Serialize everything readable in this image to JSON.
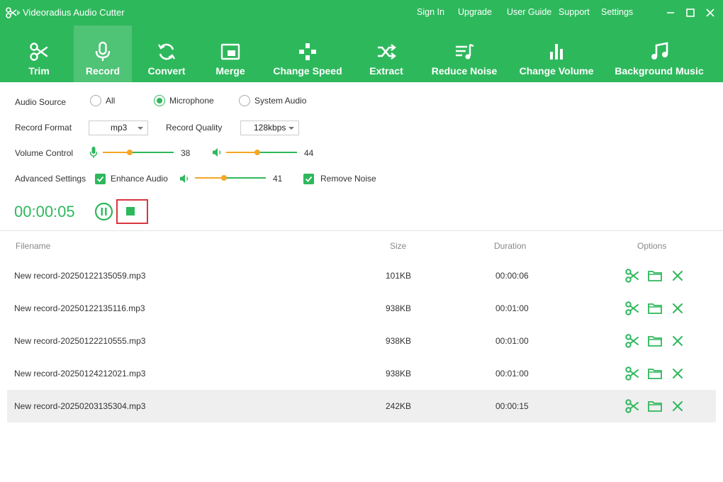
{
  "app": {
    "title": "Videoradius Audio Cutter"
  },
  "topnav": [
    "Sign In",
    "Upgrade",
    "User Guide",
    "Support",
    "Settings"
  ],
  "toolbar": [
    {
      "label": "Trim",
      "icon": "scissors-icon"
    },
    {
      "label": "Record",
      "icon": "microphone-icon",
      "active": true
    },
    {
      "label": "Convert",
      "icon": "refresh-icon"
    },
    {
      "label": "Merge",
      "icon": "merge-icon"
    },
    {
      "label": "Change Speed",
      "icon": "gamepad-icon"
    },
    {
      "label": "Extract",
      "icon": "shuffle-icon"
    },
    {
      "label": "Reduce Noise",
      "icon": "noise-icon"
    },
    {
      "label": "Change Volume",
      "icon": "bar-chart-icon"
    },
    {
      "label": "Background Music",
      "icon": "music-note-icon"
    }
  ],
  "settings": {
    "audio_source_label": "Audio Source",
    "audio_sources": [
      "All",
      "Microphone",
      "System Audio"
    ],
    "audio_source_selected": "Microphone",
    "record_format_label": "Record Format",
    "record_format": "mp3",
    "record_quality_label": "Record Quality",
    "record_quality": "128kbps",
    "volume_control_label": "Volume Control",
    "mic_volume": "38",
    "system_volume": "44",
    "advanced_label": "Advanced Settings",
    "enhance_audio_label": "Enhance Audio",
    "enhance_audio_checked": true,
    "enhance_volume": "41",
    "remove_noise_label": "Remove Noise",
    "remove_noise_checked": true
  },
  "recording": {
    "timer": "00:00:05"
  },
  "table": {
    "headers": {
      "filename": "Filename",
      "size": "Size",
      "duration": "Duration",
      "options": "Options"
    },
    "rows": [
      {
        "filename": "New record-20250122135059.mp3",
        "size": "101KB",
        "duration": "00:00:06"
      },
      {
        "filename": "New record-20250122135116.mp3",
        "size": "938KB",
        "duration": "00:01:00"
      },
      {
        "filename": "New record-20250122210555.mp3",
        "size": "938KB",
        "duration": "00:01:00"
      },
      {
        "filename": "New record-20250124212021.mp3",
        "size": "938KB",
        "duration": "00:01:00"
      },
      {
        "filename": "New record-20250203135304.mp3",
        "size": "242KB",
        "duration": "00:00:15",
        "selected": true
      }
    ]
  },
  "colors": {
    "brand": "#2eb85c",
    "slider": "#f5a623",
    "highlight": "#d9363e"
  }
}
